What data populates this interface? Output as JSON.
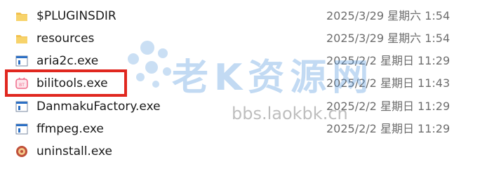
{
  "files": [
    {
      "name": "$PLUGINSDIR",
      "date": "2025/3/29 星期六 1:54",
      "icon": "folder-icon"
    },
    {
      "name": "resources",
      "date": "2025/3/29 星期六 1:54",
      "icon": "folder-icon"
    },
    {
      "name": "aria2c.exe",
      "date": "2025/2/2 星期日 11:29",
      "icon": "exe-icon"
    },
    {
      "name": "bilitools.exe",
      "date": "2025/2/2 星期日 11:43",
      "icon": "bilitools-app-icon"
    },
    {
      "name": "DanmakuFactory.exe",
      "date": "2025/2/2 星期日 11:29",
      "icon": "exe-icon"
    },
    {
      "name": "ffmpeg.exe",
      "date": "2025/2/2 星期日 11:29",
      "icon": "exe-icon"
    },
    {
      "name": "uninstall.exe",
      "date": "",
      "icon": "uninstaller-icon"
    }
  ],
  "watermark": {
    "logo_text": "老K资源网",
    "url": "bbs.laokbk.cn"
  },
  "colors": {
    "highlight": "#e0271f",
    "folder": "#f2c14e",
    "exe_accent": "#2b6fc4",
    "bilitools": "#f06a8a"
  }
}
